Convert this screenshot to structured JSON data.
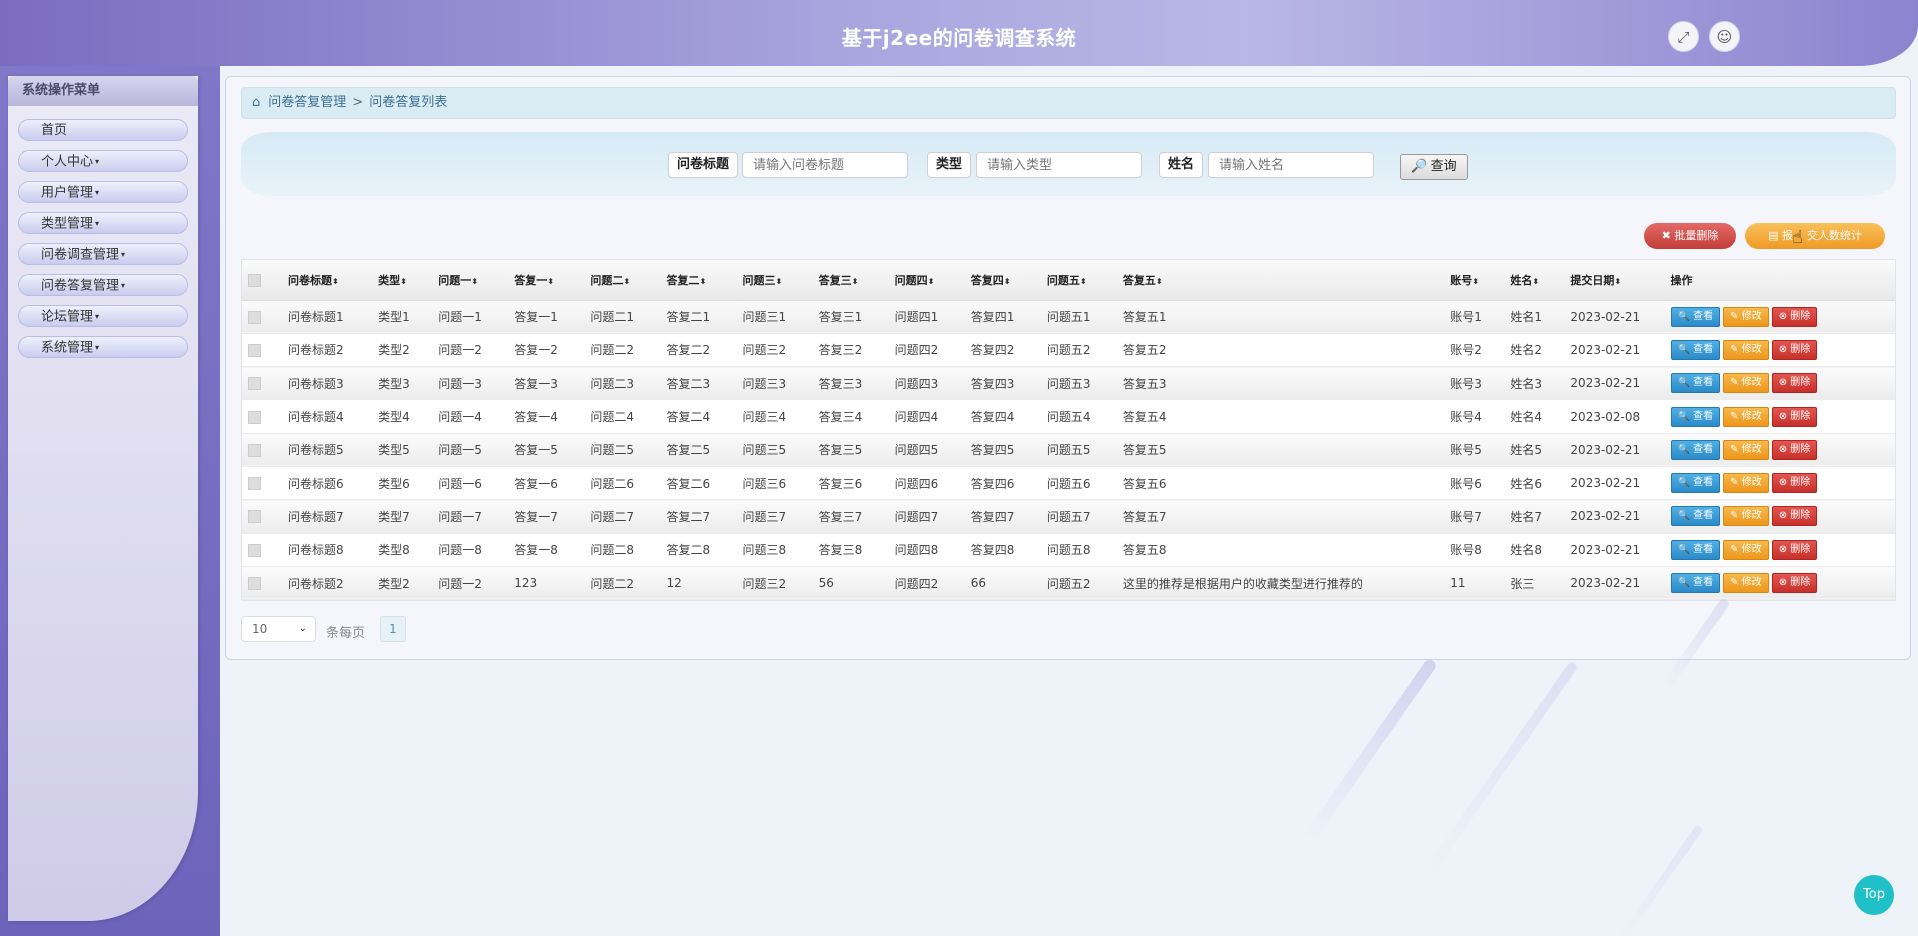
{
  "header": {
    "title": "基于j2ee的问卷调查系统",
    "expand_icon": "⤢",
    "user_icon": "☺"
  },
  "sidebar": {
    "title": "系统操作菜单",
    "items": [
      {
        "label": "首页",
        "caret": ""
      },
      {
        "label": "个人中心",
        "caret": "▾"
      },
      {
        "label": "用户管理",
        "caret": "▾"
      },
      {
        "label": "类型管理",
        "caret": "▾"
      },
      {
        "label": "问卷调查管理",
        "caret": "▾"
      },
      {
        "label": "问卷答复管理",
        "caret": "▾"
      },
      {
        "label": "论坛管理",
        "caret": "▾"
      },
      {
        "label": "系统管理",
        "caret": "▾"
      }
    ]
  },
  "breadcrumb": {
    "home_icon": "⌂",
    "level1": "问卷答复管理",
    "separator": ">",
    "level2": "问卷答复列表"
  },
  "search": {
    "title_label": "问卷标题",
    "title_placeholder": "请输入问卷标题",
    "type_label": "类型",
    "type_placeholder": "请输入类型",
    "name_label": "姓名",
    "name_placeholder": "请输入姓名",
    "button_icon": "🔎",
    "button_label": "查询"
  },
  "actions": {
    "batch_delete": "✖ 批量删除",
    "stat_prefix": "▤ 报",
    "stat_suffix": "交人数统计"
  },
  "table": {
    "sort_icon": "⬍",
    "headers": [
      "问卷标题",
      "类型",
      "问题一",
      "答复一",
      "问题二",
      "答复二",
      "问题三",
      "答复三",
      "问题四",
      "答复四",
      "问题五",
      "答复五",
      "账号",
      "姓名",
      "提交日期",
      "操作"
    ],
    "buttons": {
      "view": "🔍 查看",
      "edit": "✎ 修改",
      "delete": "⊗ 删除"
    },
    "rows": [
      [
        "问卷标题1",
        "类型1",
        "问题一1",
        "答复一1",
        "问题二1",
        "答复二1",
        "问题三1",
        "答复三1",
        "问题四1",
        "答复四1",
        "问题五1",
        "答复五1",
        "账号1",
        "姓名1",
        "2023-02-21"
      ],
      [
        "问卷标题2",
        "类型2",
        "问题一2",
        "答复一2",
        "问题二2",
        "答复二2",
        "问题三2",
        "答复三2",
        "问题四2",
        "答复四2",
        "问题五2",
        "答复五2",
        "账号2",
        "姓名2",
        "2023-02-21"
      ],
      [
        "问卷标题3",
        "类型3",
        "问题一3",
        "答复一3",
        "问题二3",
        "答复二3",
        "问题三3",
        "答复三3",
        "问题四3",
        "答复四3",
        "问题五3",
        "答复五3",
        "账号3",
        "姓名3",
        "2023-02-21"
      ],
      [
        "问卷标题4",
        "类型4",
        "问题一4",
        "答复一4",
        "问题二4",
        "答复二4",
        "问题三4",
        "答复三4",
        "问题四4",
        "答复四4",
        "问题五4",
        "答复五4",
        "账号4",
        "姓名4",
        "2023-02-08"
      ],
      [
        "问卷标题5",
        "类型5",
        "问题一5",
        "答复一5",
        "问题二5",
        "答复二5",
        "问题三5",
        "答复三5",
        "问题四5",
        "答复四5",
        "问题五5",
        "答复五5",
        "账号5",
        "姓名5",
        "2023-02-21"
      ],
      [
        "问卷标题6",
        "类型6",
        "问题一6",
        "答复一6",
        "问题二6",
        "答复二6",
        "问题三6",
        "答复三6",
        "问题四6",
        "答复四6",
        "问题五6",
        "答复五6",
        "账号6",
        "姓名6",
        "2023-02-21"
      ],
      [
        "问卷标题7",
        "类型7",
        "问题一7",
        "答复一7",
        "问题二7",
        "答复二7",
        "问题三7",
        "答复三7",
        "问题四7",
        "答复四7",
        "问题五7",
        "答复五7",
        "账号7",
        "姓名7",
        "2023-02-21"
      ],
      [
        "问卷标题8",
        "类型8",
        "问题一8",
        "答复一8",
        "问题二8",
        "答复二8",
        "问题三8",
        "答复三8",
        "问题四8",
        "答复四8",
        "问题五8",
        "答复五8",
        "账号8",
        "姓名8",
        "2023-02-21"
      ],
      [
        "问卷标题2",
        "类型2",
        "问题一2",
        "123",
        "问题二2",
        "12",
        "问题三2",
        "56",
        "问题四2",
        "66",
        "问题五2",
        "这里的推荐是根据用户的收藏类型进行推荐的",
        "11",
        "张三",
        "2023-02-21"
      ]
    ]
  },
  "pager": {
    "page_size": "10",
    "chevron": "⌄",
    "label": "条每页",
    "current_page": "1"
  },
  "top_button": "Top"
}
